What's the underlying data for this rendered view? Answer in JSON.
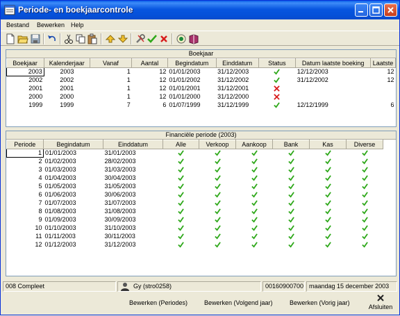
{
  "window": {
    "title": "Periode- en boekjaarcontrole"
  },
  "menu": [
    "Bestand",
    "Bewerken",
    "Help"
  ],
  "toolbar": {
    "icons": [
      "new-icon",
      "open-icon",
      "save-icon",
      "undo-icon",
      "cut-icon",
      "copy-icon",
      "paste-icon",
      "arrow-up-icon",
      "arrow-down-icon",
      "tools-icon",
      "check-icon",
      "delete-icon",
      "help-icon",
      "book-icon"
    ]
  },
  "boekjaar": {
    "title": "Boekjaar",
    "headers": [
      "Boekjaar",
      "Kalenderjaar",
      "Vanaf",
      "Aantal",
      "Begindatum",
      "Einddatum",
      "Status",
      "Datum laatste boeking",
      "Laatste"
    ],
    "rows": [
      {
        "boekjaar": "2003",
        "kalenderjaar": "2003",
        "vanaf": "1",
        "aantal": "12",
        "begindatum": "01/01/2003",
        "einddatum": "31/12/2003",
        "status": "ok",
        "laatste_boeking": "12/12/2003",
        "laatste": "12"
      },
      {
        "boekjaar": "2002",
        "kalenderjaar": "2002",
        "vanaf": "1",
        "aantal": "12",
        "begindatum": "01/01/2002",
        "einddatum": "31/12/2002",
        "status": "ok",
        "laatste_boeking": "31/12/2002",
        "laatste": "12"
      },
      {
        "boekjaar": "2001",
        "kalenderjaar": "2001",
        "vanaf": "1",
        "aantal": "12",
        "begindatum": "01/01/2001",
        "einddatum": "31/12/2001",
        "status": "error",
        "laatste_boeking": "",
        "laatste": ""
      },
      {
        "boekjaar": "2000",
        "kalenderjaar": "2000",
        "vanaf": "1",
        "aantal": "12",
        "begindatum": "01/01/2000",
        "einddatum": "31/12/2000",
        "status": "error",
        "laatste_boeking": "",
        "laatste": ""
      },
      {
        "boekjaar": "1999",
        "kalenderjaar": "1999",
        "vanaf": "7",
        "aantal": "6",
        "begindatum": "01/07/1999",
        "einddatum": "31/12/1999",
        "status": "ok",
        "laatste_boeking": "12/12/1999",
        "laatste": "6"
      }
    ]
  },
  "periode": {
    "title": "Financiële periode (2003)",
    "headers": [
      "Periode",
      "Begindatum",
      "Einddatum",
      "Alle",
      "Verkoop",
      "Aankoop",
      "Bank",
      "Kas",
      "Diverse"
    ],
    "rows": [
      {
        "periode": "1",
        "begindatum": "01/01/2003",
        "einddatum": "31/01/2003"
      },
      {
        "periode": "2",
        "begindatum": "01/02/2003",
        "einddatum": "28/02/2003"
      },
      {
        "periode": "3",
        "begindatum": "01/03/2003",
        "einddatum": "31/03/2003"
      },
      {
        "periode": "4",
        "begindatum": "01/04/2003",
        "einddatum": "30/04/2003"
      },
      {
        "periode": "5",
        "begindatum": "01/05/2003",
        "einddatum": "31/05/2003"
      },
      {
        "periode": "6",
        "begindatum": "01/06/2003",
        "einddatum": "30/06/2003"
      },
      {
        "periode": "7",
        "begindatum": "01/07/2003",
        "einddatum": "31/07/2003"
      },
      {
        "periode": "8",
        "begindatum": "01/08/2003",
        "einddatum": "31/08/2003"
      },
      {
        "periode": "9",
        "begindatum": "01/09/2003",
        "einddatum": "30/09/2003"
      },
      {
        "periode": "10",
        "begindatum": "01/10/2003",
        "einddatum": "31/10/2003"
      },
      {
        "periode": "11",
        "begindatum": "01/11/2003",
        "einddatum": "30/11/2003"
      },
      {
        "periode": "12",
        "begindatum": "01/12/2003",
        "einddatum": "31/12/2003"
      }
    ],
    "status_all": "ok"
  },
  "statusbar": {
    "left": "008 Compleet",
    "user": "Gy (stro0258)",
    "code": "00160900700",
    "date": "maandag 15 december 2003"
  },
  "buttons": {
    "periodes": "Bewerken (Periodes)",
    "volgend": "Bewerken (Volgend jaar)",
    "vorig": "Bewerken (Vorig jaar)",
    "afsluiten": "Afsluiten"
  },
  "colors": {
    "check": "#2ea81a",
    "cross": "#d81c1c",
    "titlebar": "#0856e0"
  }
}
